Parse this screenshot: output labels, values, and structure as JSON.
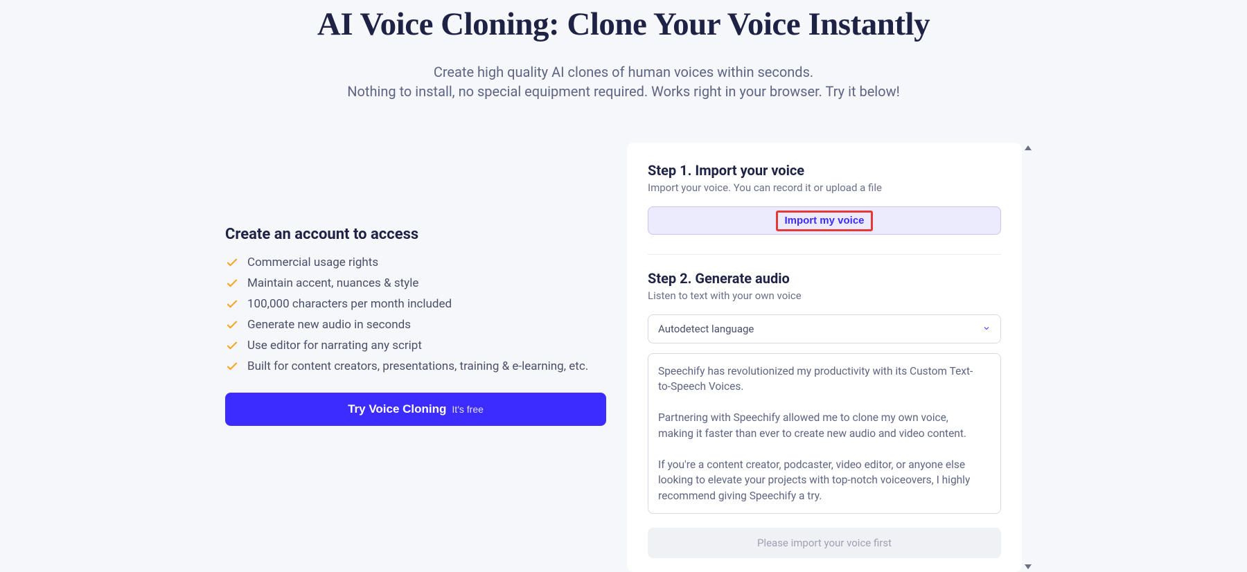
{
  "header": {
    "title": "AI Voice Cloning: Clone Your Voice Instantly",
    "subtitle_line1": "Create high quality AI clones of human voices within seconds.",
    "subtitle_line2": "Nothing to install, no special equipment required. Works right in your browser. Try it below!"
  },
  "left": {
    "heading": "Create an account to access",
    "features": [
      "Commercial usage rights",
      "Maintain accent, nuances & style",
      "100,000 characters per month included",
      "Generate new audio in seconds",
      "Use editor for narrating any script",
      "Built for content creators, presentations, training & e-learning, etc."
    ],
    "cta_label": "Try Voice Cloning",
    "cta_sub": "It's free"
  },
  "right": {
    "step1_title": "Step 1. Import your voice",
    "step1_desc": "Import your voice. You can record it or upload a file",
    "import_button": "Import my voice",
    "step2_title": "Step 2. Generate audio",
    "step2_desc": "Listen to text with your own voice",
    "language_selected": "Autodetect language",
    "textarea_value": "Speechify has revolutionized my productivity with its Custom Text-to-Speech Voices.\n\nPartnering with Speechify allowed me to clone my own voice, making it faster than ever to create new audio and video content.\n\nIf you're a content creator, podcaster, video editor, or anyone else looking to elevate your projects with top-notch voiceovers, I highly recommend giving Speechify a try.",
    "disabled_label": "Please import your voice first"
  }
}
